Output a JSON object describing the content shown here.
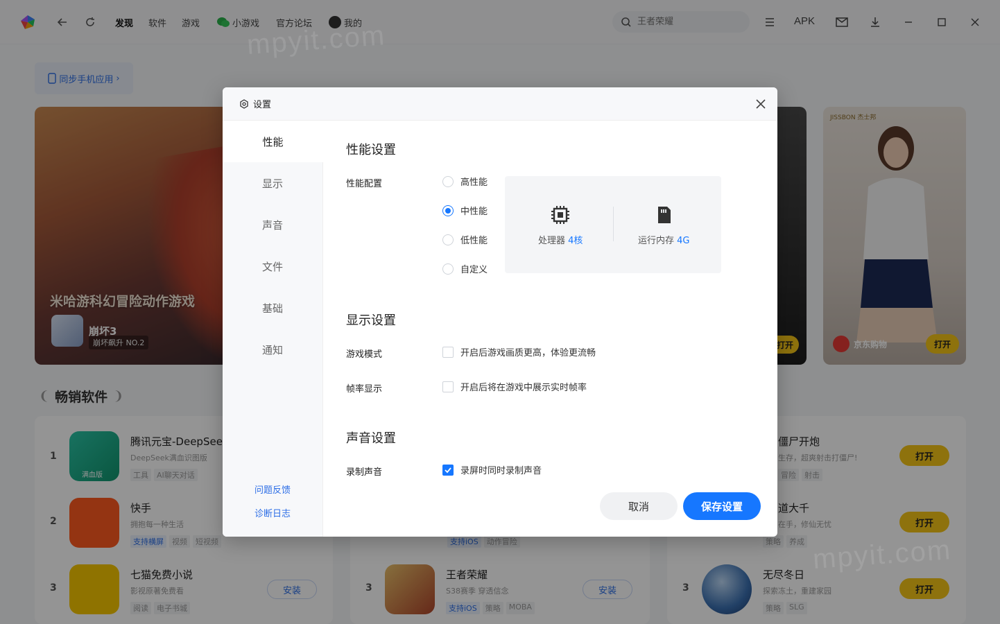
{
  "titlebar": {
    "nav": [
      "发现",
      "软件",
      "游戏",
      "小游戏",
      "官方论坛",
      "我的"
    ],
    "search_placeholder": "王者荣耀",
    "apk_label": "APK"
  },
  "home": {
    "sync_label": "同步手机应用",
    "banner1": {
      "title": "米哈游科幻冒险动作游戏",
      "game": "崩坏3",
      "rank": "崩坏飙升 NO.2"
    },
    "banner3": {
      "open_label": "打开"
    },
    "banner4": {
      "brand": "JISSBON 杰士邦",
      "app": "京东购物",
      "open_label": "打开"
    },
    "section_title": "畅销软件",
    "col1": [
      {
        "rank": "1",
        "name": "腾讯元宝-DeepSee",
        "desc": "DeepSeek满血识图版",
        "tags": [
          "工具",
          "AI聊天对话"
        ],
        "icon_text": "满血版"
      },
      {
        "rank": "2",
        "name": "快手",
        "desc": "拥抱每一种生活",
        "tags": [
          "支持横屏",
          "视频",
          "短视频"
        ]
      },
      {
        "rank": "3",
        "name": "七猫免费小说",
        "desc": "影视原著免费看",
        "tags": [
          "阅读",
          "电子书城"
        ],
        "button": "安装"
      }
    ],
    "col2": [
      {
        "tags": [
          "支持iOS",
          "动作冒险"
        ]
      },
      {
        "rank": "3",
        "name": "王者荣耀",
        "desc": "S38赛季 穿透信念",
        "tags": [
          "支持iOS",
          "策略",
          "MOBA"
        ],
        "button": "安装"
      }
    ],
    "col3": [
      {
        "name": "僵尸开炮",
        "desc": "生存，超爽射击打僵尸!",
        "tags": [
          "冒险",
          "射击"
        ],
        "button": "打开"
      },
      {
        "name": "道大千",
        "desc": "在手，修仙无忧",
        "tags": [
          "策略",
          "养成"
        ],
        "button": "打开"
      },
      {
        "rank": "3",
        "name": "无尽冬日",
        "desc": "探索冻土，重建家园",
        "tags": [
          "策略",
          "SLG"
        ],
        "button": "打开"
      }
    ]
  },
  "watermark": "mpyit.com",
  "settings": {
    "title": "设置",
    "sidebar": [
      "性能",
      "显示",
      "声音",
      "文件",
      "基础",
      "通知"
    ],
    "active_tab": "性能",
    "links": {
      "feedback": "问题反馈",
      "diagnostic": "诊断日志"
    },
    "performance": {
      "section_title": "性能设置",
      "config_label": "性能配置",
      "options": [
        "高性能",
        "中性能",
        "低性能",
        "自定义"
      ],
      "selected": "中性能",
      "cpu_label": "处理器",
      "cpu_value": "4核",
      "ram_label": "运行内存",
      "ram_value": "4G"
    },
    "display": {
      "section_title": "显示设置",
      "game_mode_label": "游戏模式",
      "game_mode_text": "开启后游戏画质更高，体验更流畅",
      "game_mode_checked": false,
      "fps_label": "帧率显示",
      "fps_text": "开启后将在游戏中展示实时帧率",
      "fps_checked": false
    },
    "sound": {
      "section_title": "声音设置",
      "record_label": "录制声音",
      "record_text": "录屏时同时录制声音",
      "record_checked": true
    },
    "buttons": {
      "cancel": "取消",
      "save": "保存设置"
    },
    "accent": "#1677ff"
  }
}
